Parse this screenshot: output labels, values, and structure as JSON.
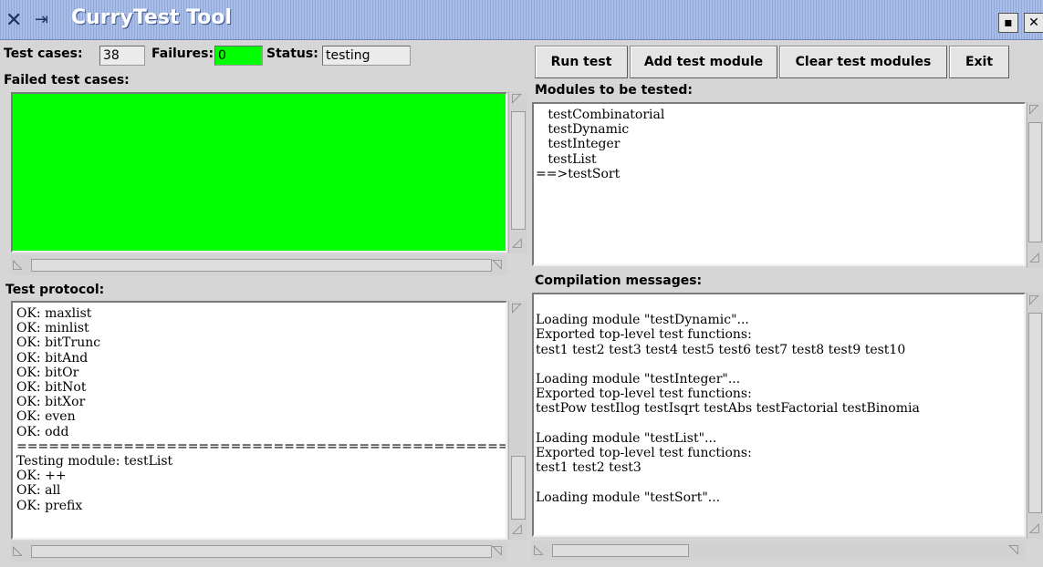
{
  "window": {
    "title": "CurryTest Tool",
    "minimize_symbol": "▪",
    "close_symbol": "✕",
    "icons": [
      "x-icon",
      "pin-icon"
    ]
  },
  "stats": {
    "test_cases_label": "Test cases:",
    "test_cases_value": "38",
    "failures_label": "Failures:",
    "failures_value": "0",
    "status_label": "Status:",
    "status_value": "testing"
  },
  "toolbar": {
    "run_label": "Run test",
    "add_label": "Add test module",
    "clear_label": "Clear test modules",
    "exit_label": "Exit"
  },
  "failed": {
    "label": "Failed test cases:",
    "background_color": "#00ff00"
  },
  "modules": {
    "label": "Modules to be tested:",
    "items": [
      "   testCombinatorial",
      "   testDynamic",
      "   testInteger",
      "   testList",
      "==>testSort"
    ]
  },
  "protocol": {
    "label": "Test protocol:",
    "lines": [
      "OK: maxlist",
      "OK: minlist",
      "OK: bitTrunc",
      "OK: bitAnd",
      "OK: bitOr",
      "OK: bitNot",
      "OK: bitXor",
      "OK: even",
      "OK: odd",
      "=============================================================",
      "Testing module: testList",
      "OK: ++",
      "OK: all",
      "OK: prefix"
    ]
  },
  "compilation": {
    "label": "Compilation messages:",
    "lines": [
      "",
      "Loading module \"testDynamic\"...",
      "Exported top-level test functions:",
      "test1 test2 test3 test4 test5 test6 test7 test8 test9 test10",
      "",
      "Loading module \"testInteger\"...",
      "Exported top-level test functions:",
      "testPow testIlog testIsqrt testAbs testFactorial testBinomia",
      "",
      "Loading module \"testList\"...",
      "Exported top-level test functions:",
      "test1 test2 test3",
      "",
      "Loading module \"testSort\"..."
    ]
  }
}
